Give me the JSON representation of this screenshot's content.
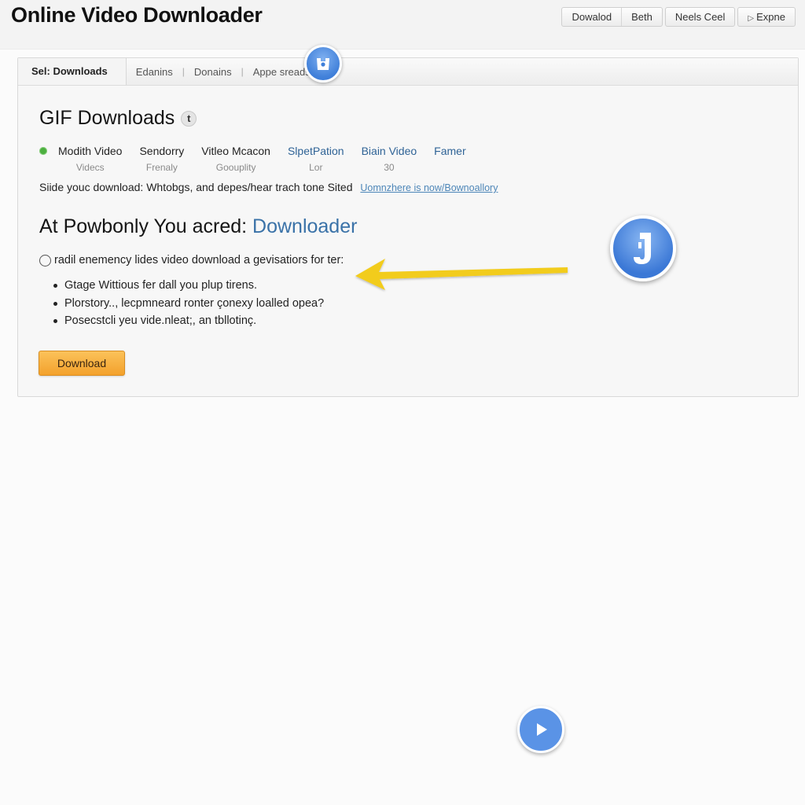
{
  "app": {
    "title": "Online Video Downloader"
  },
  "toolbar": {
    "group": [
      "Dowalod",
      "Beth"
    ],
    "neels_label": "Neels Ceel",
    "expne_label": "Expne"
  },
  "tabs": {
    "active": "Sel: Downloads",
    "items": [
      "Edanins",
      "Donains",
      "Appe sreads:"
    ]
  },
  "section": {
    "title": "GIF Downloads",
    "info_glyph": "t"
  },
  "categories": [
    {
      "name": "Modith Video",
      "sub": "Videcs"
    },
    {
      "name": "Sendorry",
      "sub": "Frenaly"
    },
    {
      "name": "Vitleo Mcacon",
      "sub": "Goouplity"
    },
    {
      "name": "SlpetPation",
      "sub": "Lor"
    },
    {
      "name": "Biain Video",
      "sub": "30"
    },
    {
      "name": "Famer",
      "sub": ""
    }
  ],
  "status_color": "#4caf3f",
  "description": {
    "text": "Siide youc download:  Whtobgs, and depes/hear trach tone Sited",
    "link": "Uomnzhere is now/Bownoallory"
  },
  "headline": {
    "prefix": "At Powbonly You acred: ",
    "accent": "Downloader"
  },
  "option": {
    "label": "radil enemency lides video download a gevisatiors for ter:"
  },
  "bullets": [
    "Gtage Wittious fer dall you plup tirens.",
    "Plorstory.., lecpmneard ronter çonexy loalled opea?",
    "Posecstcli yeu vide.nleat;, an tbllotinç."
  ],
  "download_button": {
    "label": "Download",
    "color": "#f3a12c"
  },
  "colors": {
    "accent_blue": "#3a72a8",
    "arrow": "#f2cc1c",
    "badge_blue": "#3b78d6"
  }
}
